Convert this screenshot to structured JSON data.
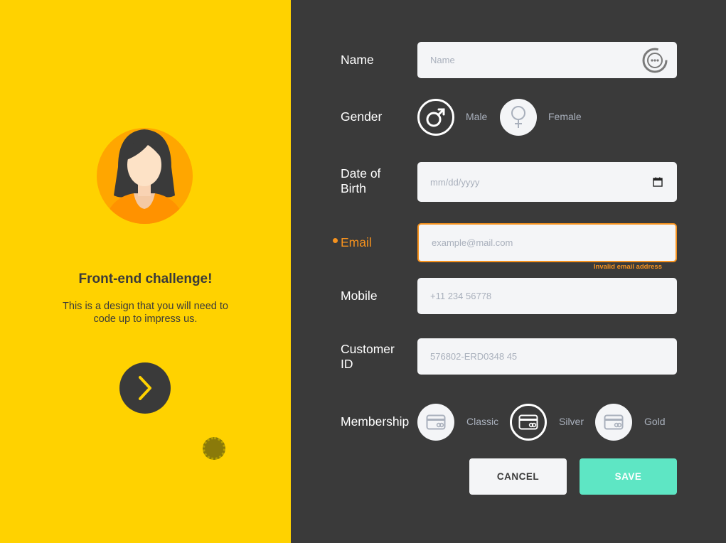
{
  "left": {
    "headline": "Front-end challenge!",
    "subtext": "This is a design that you will need to code up to impress us.",
    "next_icon": "chevron-right-icon"
  },
  "form": {
    "name": {
      "label": "Name",
      "placeholder": "Name",
      "icon": "password-dots-icon"
    },
    "gender": {
      "label": "Gender",
      "options": [
        {
          "label": "Male",
          "icon": "male-icon",
          "selected": true
        },
        {
          "label": "Female",
          "icon": "female-icon",
          "selected": false
        }
      ]
    },
    "dob": {
      "label": "Date of Birth",
      "placeholder": "mm/dd/yyyy",
      "icon": "calendar-icon"
    },
    "email": {
      "label": "Email",
      "placeholder": "example@mail.com",
      "error": "Invalid email address"
    },
    "mobile": {
      "label": "Mobile",
      "placeholder": "+11 234 56778"
    },
    "customer_id": {
      "label": "Customer ID",
      "placeholder": "576802-ERD0348 45"
    },
    "membership": {
      "label": "Membership",
      "options": [
        {
          "label": "Classic",
          "icon": "credit-card-icon",
          "selected": false
        },
        {
          "label": "Silver",
          "icon": "credit-card-icon",
          "selected": true
        },
        {
          "label": "Gold",
          "icon": "credit-card-icon",
          "selected": false
        }
      ]
    }
  },
  "actions": {
    "cancel": "CANCEL",
    "save": "SAVE"
  },
  "colors": {
    "yellow": "#ffd200",
    "dark": "#3a3a3a",
    "field_bg": "#f4f5f7",
    "error": "#f6921e",
    "save": "#5ee6c4",
    "avatar_bg": "#ffa600"
  }
}
